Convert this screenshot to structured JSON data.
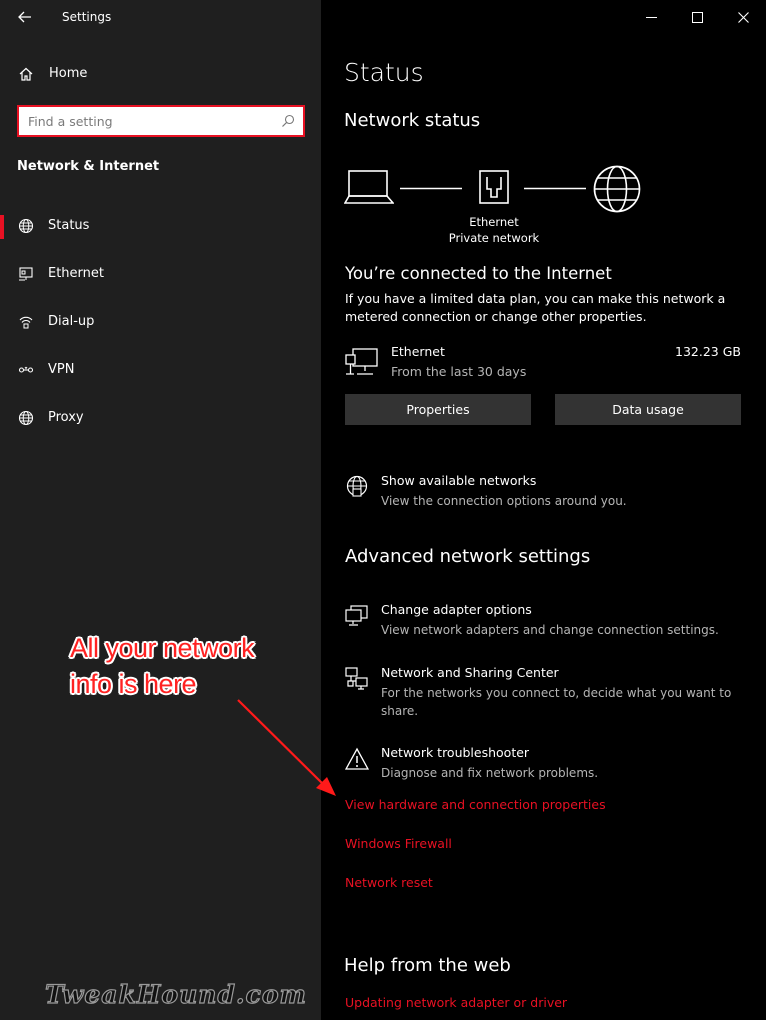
{
  "window": {
    "title": "Settings",
    "controls": [
      "minimize",
      "maximize",
      "close"
    ]
  },
  "sidebar": {
    "home_label": "Home",
    "search_placeholder": "Find a setting",
    "section_title": "Network & Internet",
    "items": [
      {
        "label": "Status",
        "icon": "globe-icon",
        "active": true
      },
      {
        "label": "Ethernet",
        "icon": "ethernet-icon",
        "active": false
      },
      {
        "label": "Dial-up",
        "icon": "dialup-icon",
        "active": false
      },
      {
        "label": "VPN",
        "icon": "vpn-icon",
        "active": false
      },
      {
        "label": "Proxy",
        "icon": "globe-icon",
        "active": false
      }
    ],
    "watermark": "TweakHound.com"
  },
  "main": {
    "page_title": "Status",
    "network_status_heading": "Network status",
    "diagram": {
      "adapter_label": "Ethernet",
      "network_label": "Private network"
    },
    "connected_title": "You’re connected to the Internet",
    "connected_desc": "If you have a limited data plan, you can make this network a metered connection or change other properties.",
    "ethernet": {
      "name": "Ethernet",
      "sub": "From the last 30 days",
      "usage": "132.23 GB"
    },
    "buttons": {
      "properties": "Properties",
      "data_usage": "Data usage"
    },
    "show_networks": {
      "title": "Show available networks",
      "desc": "View the connection options around you."
    },
    "advanced_heading": "Advanced network settings",
    "advanced_options": [
      {
        "title": "Change adapter options",
        "desc": "View network adapters and change connection settings."
      },
      {
        "title": "Network and Sharing Center",
        "desc": "For the networks you connect to, decide what you want to share."
      },
      {
        "title": "Network troubleshooter",
        "desc": "Diagnose and fix network problems."
      }
    ],
    "links": {
      "hardware": "View hardware and connection properties",
      "firewall": "Windows Firewall",
      "reset": "Network reset"
    },
    "help_heading": "Help from the web",
    "help_links": {
      "update_driver": "Updating network adapter or driver"
    }
  },
  "annotation": {
    "line1": "All your network",
    "line2": "info is here"
  },
  "colors": {
    "accent": "#e81123",
    "sidebar_bg": "#1f1f1f",
    "main_bg": "#000000",
    "button_bg": "#333333",
    "annotation_red": "#ff2222"
  }
}
